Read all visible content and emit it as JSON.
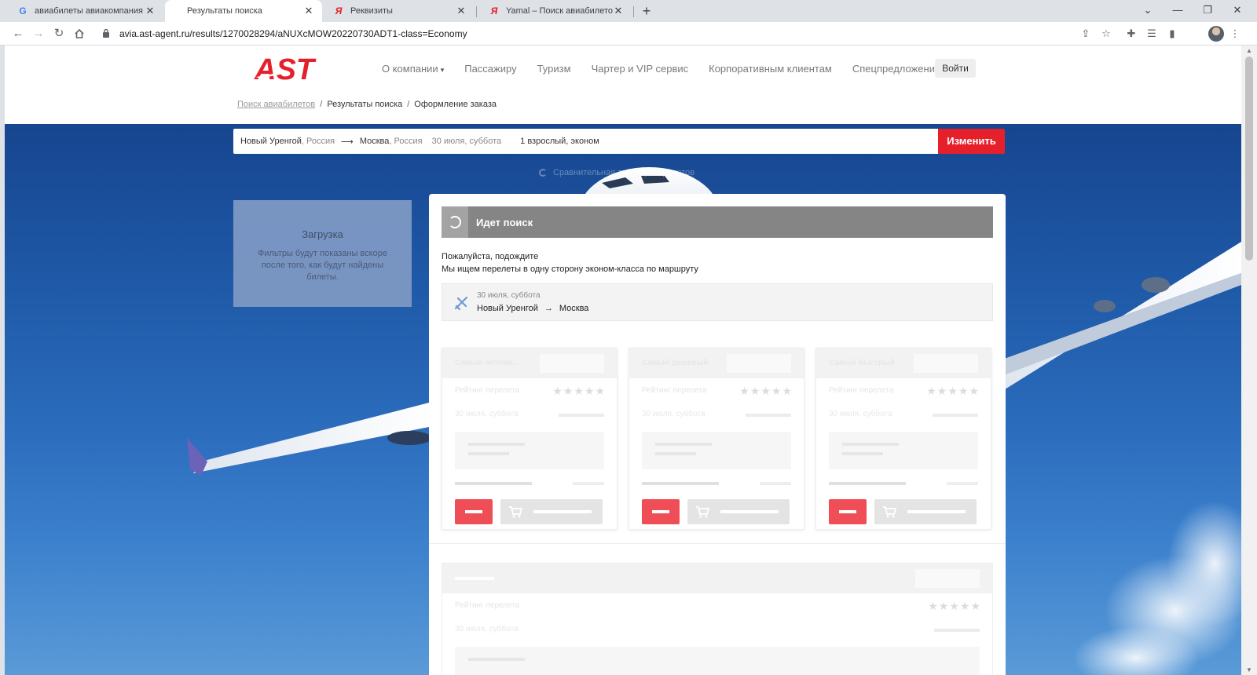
{
  "browser": {
    "tabs": [
      {
        "title": "авиабилеты авиакомпания ямал",
        "favicon": "G",
        "active": false
      },
      {
        "title": "Результаты поиска",
        "favicon": "",
        "active": true
      },
      {
        "title": "Реквизиты",
        "favicon": "Я",
        "active": false
      },
      {
        "title": "Yamal – Поиск авиабилетов",
        "favicon": "Я",
        "active": false
      }
    ],
    "new_tab": "+",
    "close": "✕",
    "url": "avia.ast-agent.ru/results/1270028294/aNUXcMOW20220730ADT1-class=Economy"
  },
  "header": {
    "logo_text": "AST",
    "menu": [
      "О компании",
      "Пассажиру",
      "Туризм",
      "Чартер и VIP сервис",
      "Корпоративным клиентам",
      "Спецпредложения"
    ],
    "login": "Войти",
    "colors": {
      "brand": "#e5202b"
    }
  },
  "breadcrumb": {
    "items": [
      "Поиск авиабилетов",
      "Результаты поиска",
      "Оформление заказа"
    ],
    "separator": "/"
  },
  "search": {
    "from_city": "Новый Уренгой",
    "from_country": ", Россия",
    "arrow": "⟶",
    "to_city": "Москва",
    "to_country": ", Россия",
    "date": "30 июля, суббота",
    "passengers": "1 взрослый, эконом",
    "change_button": "Изменить",
    "compare_link": "Сравнительная таблица перелетов"
  },
  "filters": {
    "title": "Загрузка",
    "description": "Фильтры будут показаны вскоре после того, как будут найдены билеты."
  },
  "results": {
    "status": "Идет поиск",
    "wait_line1": "Пожалуйста, подождите",
    "wait_line2": "Мы ищем перелеты в одну сторону эконом-класса по маршруту",
    "segment": {
      "date": "30 июля, суббота",
      "from": "Новый Уренгой",
      "arrow": "→",
      "to": "Москва"
    },
    "cards": [
      {
        "title": "Самый оптима...",
        "rating_label": "Рейтинг перелета",
        "date": "30 июля, суббота"
      },
      {
        "title": "Самый дешевый",
        "rating_label": "Рейтинг перелета",
        "date": "30 июля, суббота"
      },
      {
        "title": "Самый быстрый",
        "rating_label": "Рейтинг перелета",
        "date": "30 июля, суббота"
      }
    ],
    "wide_card": {
      "rating_label": "Рейтинг перелета",
      "date": "30 июля, суббота"
    },
    "stars": "★★★★★"
  }
}
